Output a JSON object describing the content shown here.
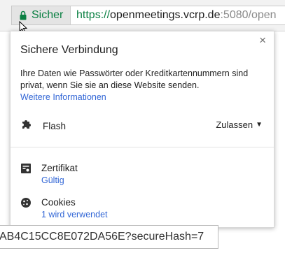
{
  "addressbar": {
    "security_label": "Sicher",
    "url_scheme": "https://",
    "url_host": "openmeetings.vcrp.de",
    "url_rest": ":5080/open"
  },
  "popup": {
    "title": "Sichere Verbindung",
    "close_glyph": "×",
    "description": "Ihre Daten wie Passwörter oder Kreditkartennummern sind privat, wenn Sie sie an diese Website senden.",
    "more_info": "Weitere Informationen",
    "flash": {
      "label": "Flash",
      "setting": "Zulassen",
      "caret": "▼"
    },
    "certificate": {
      "label": "Zertifikat",
      "status": "Gültig"
    },
    "cookies": {
      "label": "Cookies",
      "status": "1 wird verwendet"
    }
  },
  "bottom_strip": {
    "text": "AB4C15CC8E072DA56E?secureHash=7"
  },
  "colors": {
    "secure_green": "#0b8043",
    "link_blue": "#3367d6"
  },
  "icons": [
    "lock-icon",
    "mouse-pointer-icon",
    "close-icon",
    "puzzle-icon",
    "certificate-icon",
    "cookie-icon",
    "caret-down-icon"
  ]
}
